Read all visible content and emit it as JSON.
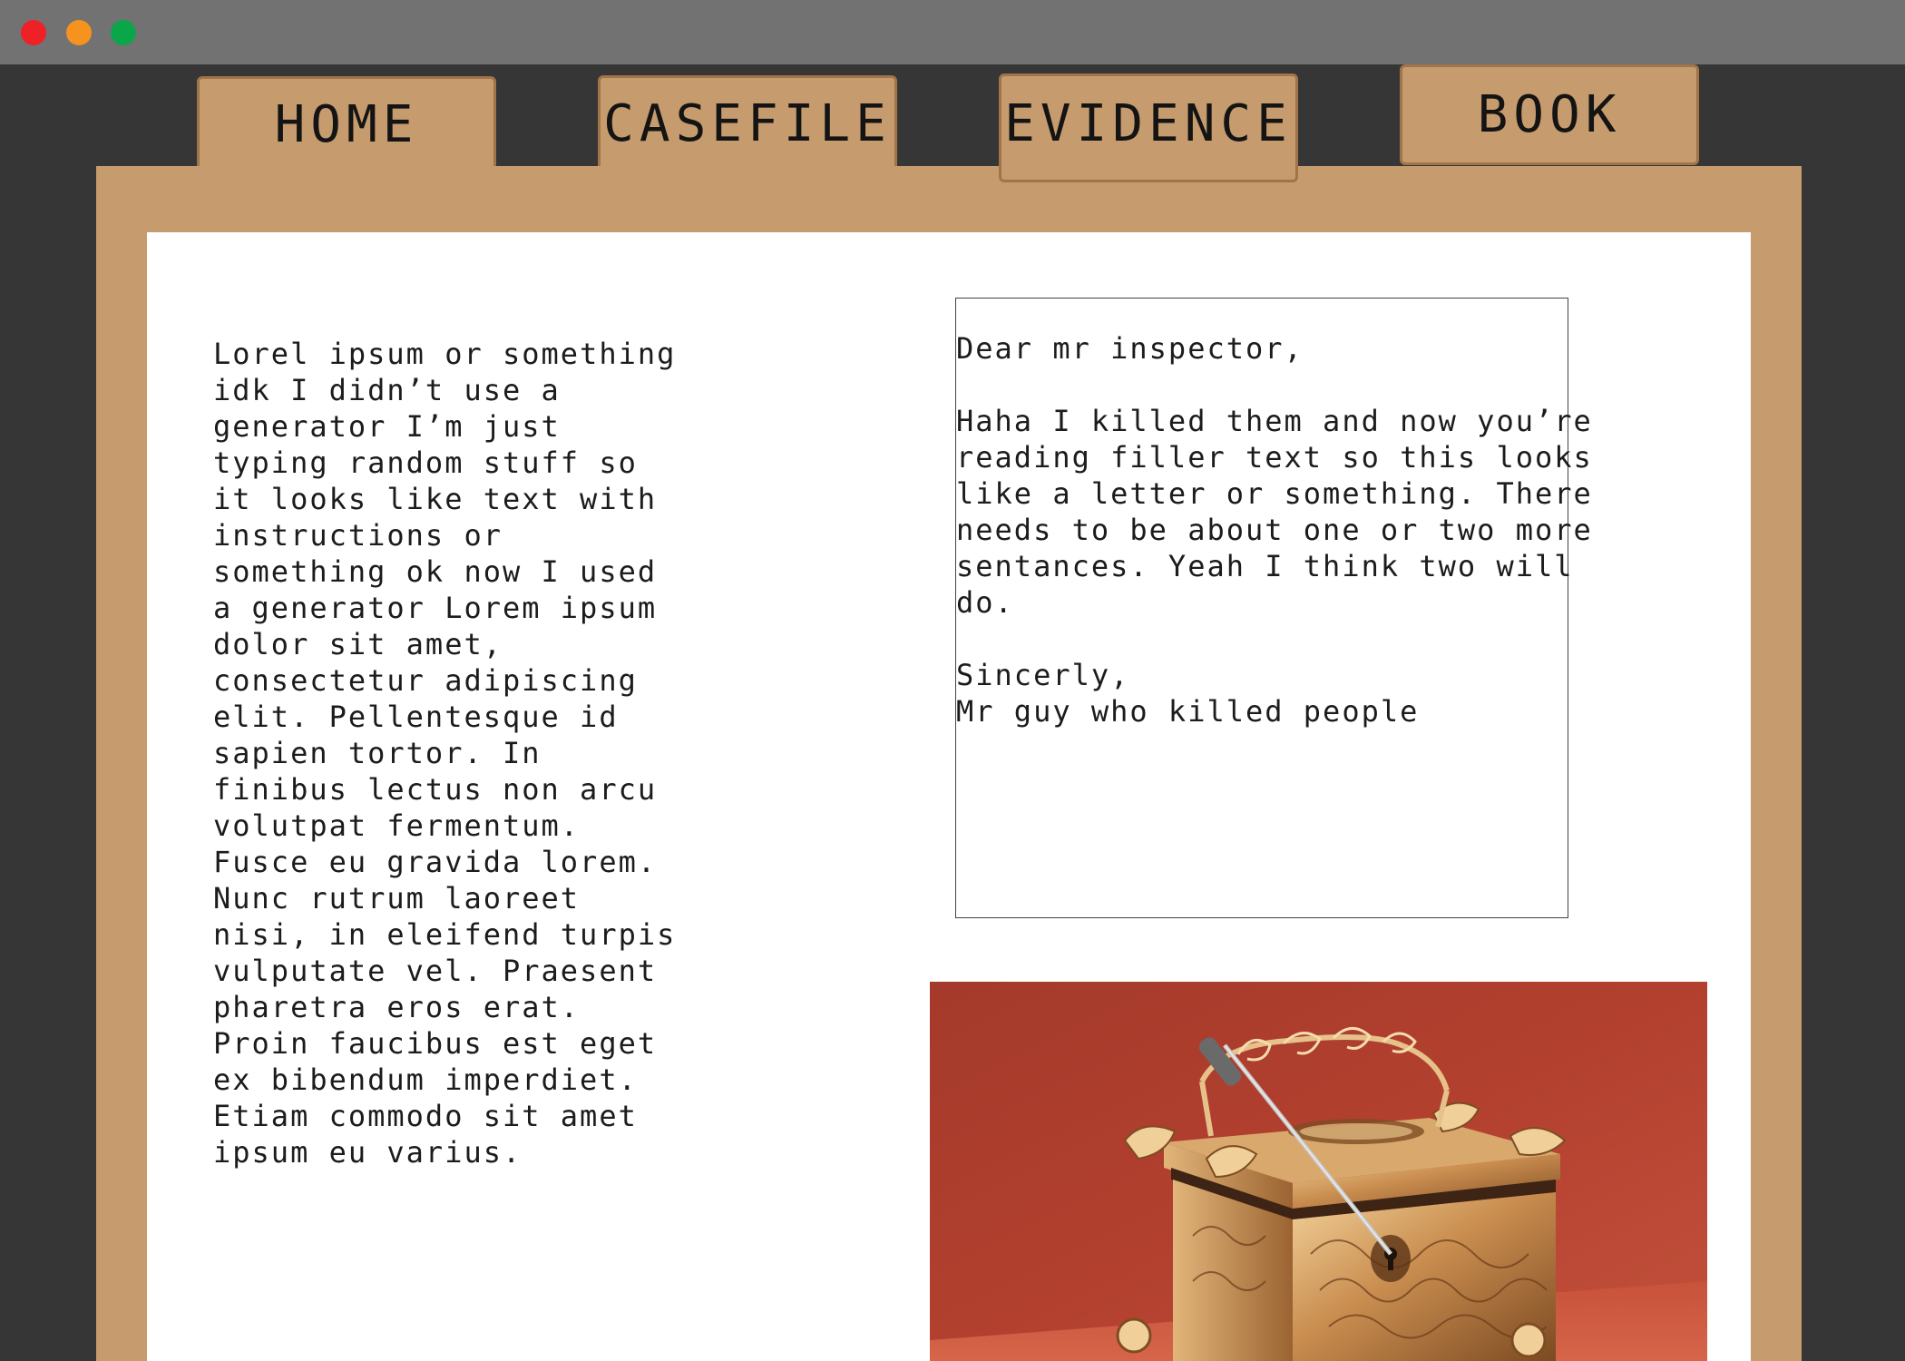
{
  "window": {
    "controls": [
      "close",
      "minimize",
      "maximize"
    ]
  },
  "nav": {
    "tabs": [
      {
        "label": "HOME"
      },
      {
        "label": "CASEFILE"
      },
      {
        "label": "EVIDENCE",
        "active": true
      },
      {
        "label": "BOOK"
      }
    ]
  },
  "colors": {
    "background": "#363636",
    "titlebar": "#727272",
    "panel": "#c69b6d",
    "sheet": "#ffffff",
    "close": "#ee2127",
    "minimize": "#f6921e",
    "maximize": "#09a64a"
  },
  "instructions": {
    "text": "Lorel ipsum or something\nidk I didn’t use a\ngenerator I’m just\ntyping random stuff so\nit looks like text with\ninstructions or\nsomething ok now I used\na generator Lorem ipsum\ndolor sit amet,\nconsectetur adipiscing\nelit. Pellentesque id\nsapien tortor. In\nfinibus lectus non arcu\nvolutpat fermentum.\nFusce eu gravida lorem.\nNunc rutrum laoreet\nnisi, in eleifend turpis\nvulputate vel. Praesent\npharetra eros erat.\nProin faucibus est eget\nex bibendum imperdiet.\nEtiam commodo sit amet\nipsum eu varius."
  },
  "letter": {
    "greeting": "Dear mr inspector,",
    "body": "Haha I killed them and now you’re\nreading filler text so this looks\nlike a letter or something. There\nneeds to be about one or two more\nsentances. Yeah I think two will\ndo.",
    "closing": "Sincerly,",
    "signature": "Mr guy who killed people"
  },
  "evidence_photo": {
    "subject": "ornate engraved metal jewelry casket with a lock pick in the keyhole, on red fabric"
  }
}
